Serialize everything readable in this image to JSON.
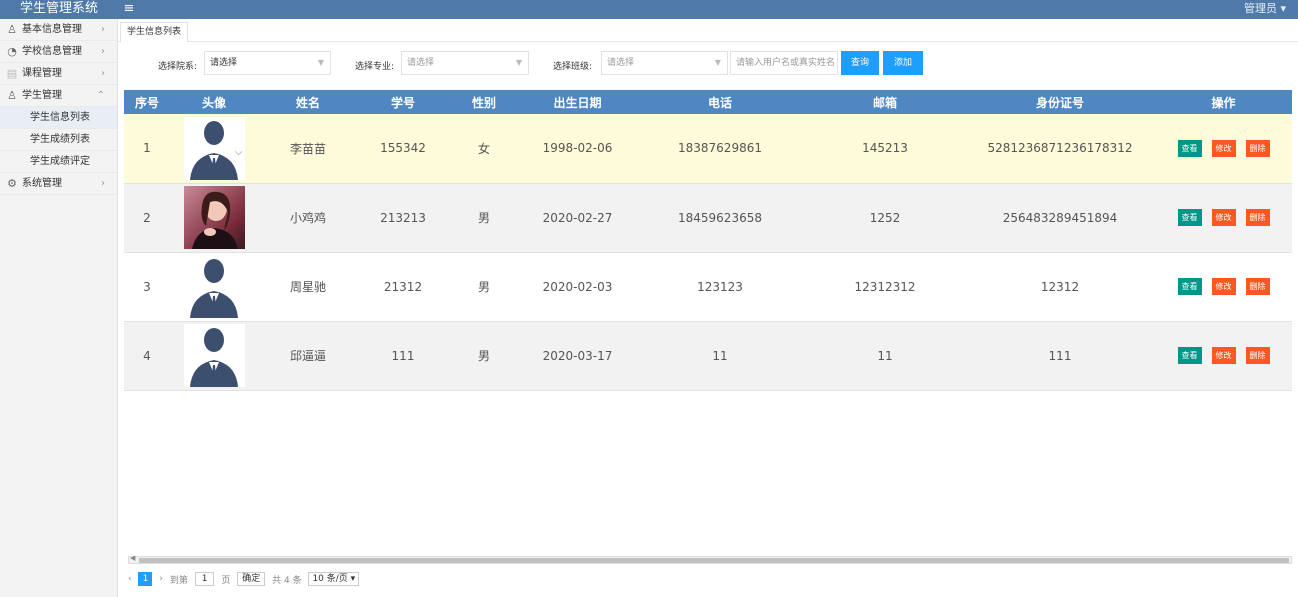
{
  "app": {
    "title": "学生管理系统",
    "user": "管理员 ▾",
    "menu_icon": "menu-icon"
  },
  "sidebar": {
    "items": [
      {
        "label": "基本信息管理",
        "icon": "user-icon"
      },
      {
        "label": "学校信息管理",
        "icon": "dashboard-icon"
      },
      {
        "label": "课程管理",
        "icon": "book-icon"
      },
      {
        "label": "学生管理",
        "icon": "student-icon"
      }
    ],
    "subitems": [
      "学生信息列表",
      "学生成绩列表",
      "学生成绩评定"
    ],
    "system": {
      "label": "系统管理",
      "icon": "gear-icon"
    }
  },
  "tabs": [
    {
      "label": "学生信息列表"
    }
  ],
  "filter": {
    "dept_label": "选择院系:",
    "dept_value": "请选择",
    "major_label": "选择专业:",
    "major_value": "请选择",
    "class_label": "选择班级:",
    "class_value": "请选择",
    "search_placeholder": "请输入用户名或真实姓名",
    "search_button": "查询",
    "add_button": "添加"
  },
  "table": {
    "headers": [
      "序号",
      "头像",
      "姓名",
      "学号",
      "性别",
      "出生日期",
      "电话",
      "邮箱",
      "身份证号",
      "操作"
    ],
    "rows": [
      {
        "no": "1",
        "name": "李苗苗",
        "sid": "155342",
        "gender": "女",
        "birth": "1998-02-06",
        "phone": "18387629861",
        "email": "145213",
        "idcard": "5281236871236178312",
        "avatar": "default"
      },
      {
        "no": "2",
        "name": "小鸡鸡",
        "sid": "213213",
        "gender": "男",
        "birth": "2020-02-27",
        "phone": "18459623658",
        "email": "1252",
        "idcard": "256483289451894",
        "avatar": "photo"
      },
      {
        "no": "3",
        "name": "周星驰",
        "sid": "21312",
        "gender": "男",
        "birth": "2020-02-03",
        "phone": "123123",
        "email": "12312312",
        "idcard": "12312",
        "avatar": "default"
      },
      {
        "no": "4",
        "name": "邱逼逼",
        "sid": "111",
        "gender": "男",
        "birth": "2020-03-17",
        "phone": "11",
        "email": "11",
        "idcard": "111",
        "avatar": "default"
      }
    ],
    "actions": {
      "view": "查看",
      "edit": "修改",
      "delete": "删除"
    }
  },
  "pager": {
    "prev": "‹",
    "current": "1",
    "next": "›",
    "goto_label": "到第",
    "page_value": "1",
    "page_unit": "页",
    "confirm": "确定",
    "total": "共 4 条",
    "per_page": "10 条/页 ▾"
  }
}
